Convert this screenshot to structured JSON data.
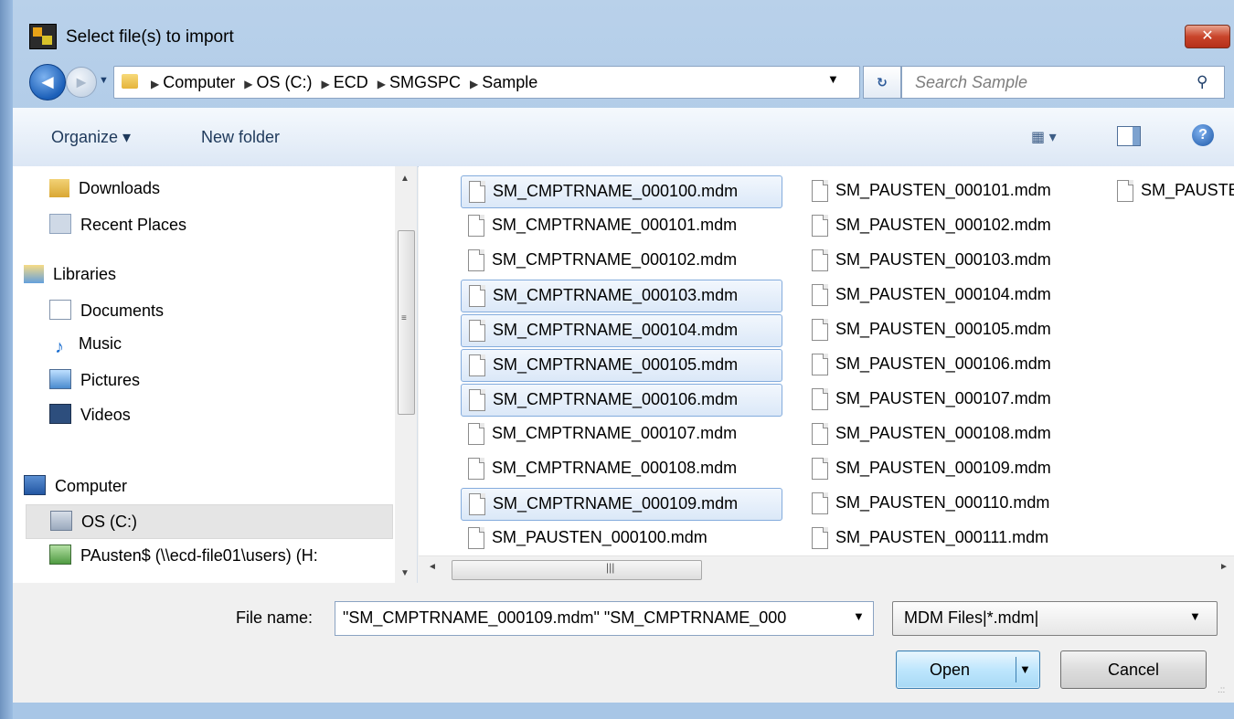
{
  "window": {
    "title": "Select file(s) to import",
    "close_glyph": "✕"
  },
  "address": {
    "back_glyph": "◄",
    "forward_glyph": "►",
    "crumbs": [
      "Computer",
      "OS (C:)",
      "ECD",
      "SMGSPC",
      "Sample"
    ],
    "refresh_glyph": "↻",
    "search_placeholder": "Search Sample"
  },
  "toolbar": {
    "organize_label": "Organize ▾",
    "new_folder_label": "New folder",
    "views_glyph": "▦ ▾",
    "help_glyph": "?"
  },
  "nav": {
    "items": [
      {
        "label": "Downloads",
        "icon": "downloads-folder-icon"
      },
      {
        "label": "Recent Places",
        "icon": "recent-places-icon"
      },
      {
        "label": "Libraries",
        "icon": "libraries-icon"
      },
      {
        "label": "Documents",
        "icon": "documents-icon"
      },
      {
        "label": "Music",
        "icon": "music-icon"
      },
      {
        "label": "Pictures",
        "icon": "pictures-icon"
      },
      {
        "label": "Videos",
        "icon": "videos-icon"
      },
      {
        "label": "Computer",
        "icon": "computer-icon"
      },
      {
        "label": "OS (C:)",
        "icon": "drive-icon",
        "selected": true
      },
      {
        "label": "PAusten$ (\\\\ecd-file01\\users) (H:",
        "icon": "network-drive-icon"
      }
    ]
  },
  "files": {
    "column1": [
      {
        "name": "SM_CMPTRNAME_000100.mdm",
        "selected": true
      },
      {
        "name": "SM_CMPTRNAME_000101.mdm",
        "selected": false
      },
      {
        "name": "SM_CMPTRNAME_000102.mdm",
        "selected": false
      },
      {
        "name": "SM_CMPTRNAME_000103.mdm",
        "selected": true
      },
      {
        "name": "SM_CMPTRNAME_000104.mdm",
        "selected": true
      },
      {
        "name": "SM_CMPTRNAME_000105.mdm",
        "selected": true
      },
      {
        "name": "SM_CMPTRNAME_000106.mdm",
        "selected": true
      },
      {
        "name": "SM_CMPTRNAME_000107.mdm",
        "selected": false
      },
      {
        "name": "SM_CMPTRNAME_000108.mdm",
        "selected": false
      },
      {
        "name": "SM_CMPTRNAME_000109.mdm",
        "selected": true
      },
      {
        "name": "SM_PAUSTEN_000100.mdm",
        "selected": false
      }
    ],
    "column2": [
      {
        "name": "SM_PAUSTEN_000101.mdm",
        "selected": false
      },
      {
        "name": "SM_PAUSTEN_000102.mdm",
        "selected": false
      },
      {
        "name": "SM_PAUSTEN_000103.mdm",
        "selected": false
      },
      {
        "name": "SM_PAUSTEN_000104.mdm",
        "selected": false
      },
      {
        "name": "SM_PAUSTEN_000105.mdm",
        "selected": false
      },
      {
        "name": "SM_PAUSTEN_000106.mdm",
        "selected": false
      },
      {
        "name": "SM_PAUSTEN_000107.mdm",
        "selected": false
      },
      {
        "name": "SM_PAUSTEN_000108.mdm",
        "selected": false
      },
      {
        "name": "SM_PAUSTEN_000109.mdm",
        "selected": false
      },
      {
        "name": "SM_PAUSTEN_000110.mdm",
        "selected": false
      },
      {
        "name": "SM_PAUSTEN_000111.mdm",
        "selected": false
      }
    ],
    "column3": [
      {
        "name": "SM_PAUSTE",
        "selected": false
      }
    ]
  },
  "bottom": {
    "file_name_label": "File name:",
    "file_name_value": "\"SM_CMPTRNAME_000109.mdm\" \"SM_CMPTRNAME_000",
    "file_type_value": "MDM Files|*.mdm|",
    "open_label": "Open",
    "cancel_label": "Cancel"
  }
}
